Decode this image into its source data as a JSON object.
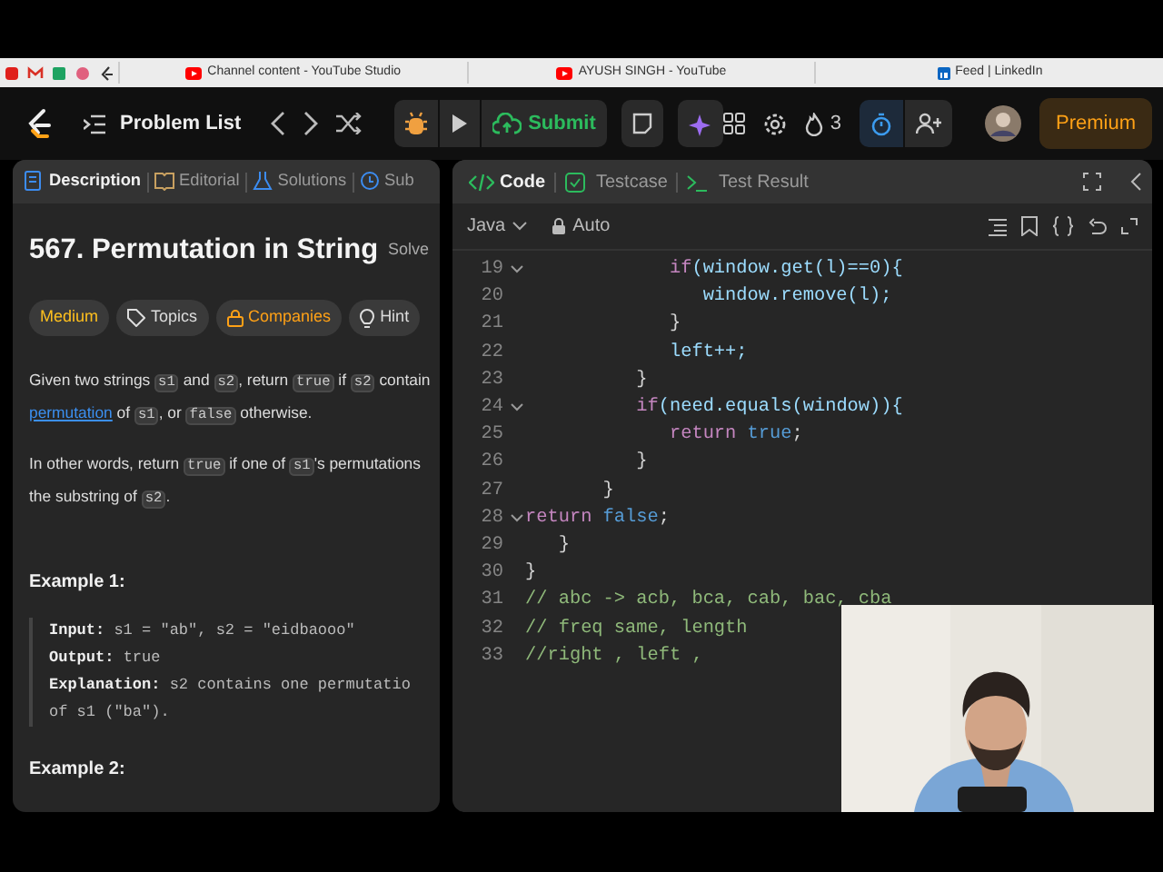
{
  "browser_tabs": [
    {
      "title": "Channel content - YouTube Studio",
      "kind": "youtube"
    },
    {
      "title": "AYUSH SINGH - YouTube",
      "kind": "youtube"
    },
    {
      "title": "Feed | LinkedIn",
      "kind": "linkedin"
    }
  ],
  "navbar": {
    "title": "Problem List",
    "submit": "Submit",
    "streak": "3",
    "premium": "Premium"
  },
  "left_tabs": [
    {
      "label": "Description",
      "selected": true,
      "kind": "doc"
    },
    {
      "label": "Editorial",
      "selected": false,
      "kind": "book"
    },
    {
      "label": "Solutions",
      "selected": false,
      "kind": "flask"
    },
    {
      "label": "Sub",
      "selected": false,
      "kind": "clock"
    }
  ],
  "problem": {
    "title": "567. Permutation in String",
    "status": "Solve",
    "tags": [
      {
        "label": "Medium",
        "kind": "difficulty"
      },
      {
        "label": "Topics",
        "kind": "tag"
      },
      {
        "label": "Companies",
        "kind": "lock"
      },
      {
        "label": "Hint",
        "kind": "bulb"
      }
    ],
    "paragraphs": [
      [
        [
          {
            "kind": "text",
            "text": "Given two strings "
          },
          {
            "kind": "code",
            "text": "s1"
          },
          {
            "kind": "text",
            "text": " and "
          },
          {
            "kind": "code",
            "text": "s2"
          },
          {
            "kind": "text",
            "text": ", return "
          },
          {
            "kind": "code",
            "text": "true"
          },
          {
            "kind": "text",
            "text": " if "
          },
          {
            "kind": "code",
            "text": "s2"
          },
          {
            "kind": "text",
            "text": " contain"
          }
        ],
        [
          {
            "kind": "link",
            "text": "permutation"
          },
          {
            "kind": "text",
            "text": " of "
          },
          {
            "kind": "code",
            "text": "s1"
          },
          {
            "kind": "text",
            "text": ", or "
          },
          {
            "kind": "code",
            "text": "false"
          },
          {
            "kind": "text",
            "text": " otherwise."
          }
        ]
      ],
      [
        [
          {
            "kind": "text",
            "text": "In other words, return "
          },
          {
            "kind": "code",
            "text": "true"
          },
          {
            "kind": "text",
            "text": " if one of "
          },
          {
            "kind": "code",
            "text": "s1"
          },
          {
            "kind": "text",
            "text": "'s permutations"
          }
        ],
        [
          {
            "kind": "text",
            "text": "the substring of "
          },
          {
            "kind": "code",
            "text": "s2"
          },
          {
            "kind": "text",
            "text": "."
          }
        ]
      ]
    ],
    "examples": [
      {
        "title": "Example 1:",
        "lines": [
          [
            {
              "kind": "label",
              "text": "Input:"
            },
            {
              "kind": "text",
              "text": " s1 = \"ab\", s2 = \"eidbaooo\""
            }
          ],
          [
            {
              "kind": "label",
              "text": "Output:"
            },
            {
              "kind": "text",
              "text": " true"
            }
          ],
          [
            {
              "kind": "label",
              "text": "Explanation:"
            },
            {
              "kind": "text",
              "text": " s2 contains one permutatio"
            }
          ],
          [
            {
              "kind": "text",
              "text": "of s1 (\"ba\")."
            }
          ]
        ]
      },
      {
        "title": "Example 2:"
      }
    ]
  },
  "code_tabs": [
    {
      "label": "Code",
      "selected": true,
      "kind": "code"
    },
    {
      "label": "Testcase",
      "selected": false,
      "kind": "check"
    },
    {
      "label": "Test Result",
      "selected": false,
      "kind": "terminal"
    }
  ],
  "editor": {
    "language": "Java",
    "mode": "Auto",
    "lines": [
      {
        "num": "19",
        "expanded": true,
        "tokens": [
          {
            "kind": "keyword",
            "text": "             if"
          },
          {
            "kind": "var",
            "text": "(window.get(l)==0){"
          }
        ]
      },
      {
        "num": "20",
        "tokens": [
          {
            "kind": "var",
            "text": "                window.remove(l);"
          }
        ]
      },
      {
        "num": "21",
        "tokens": [
          {
            "kind": "plain",
            "text": "             }"
          }
        ]
      },
      {
        "num": "22",
        "tokens": [
          {
            "kind": "var",
            "text": "             left++;"
          }
        ]
      },
      {
        "num": "23",
        "tokens": [
          {
            "kind": "plain",
            "text": "          }"
          }
        ]
      },
      {
        "num": "24",
        "expanded": true,
        "tokens": [
          {
            "kind": "keyword",
            "text": "          if"
          },
          {
            "kind": "var",
            "text": "(need.equals(window)){"
          }
        ]
      },
      {
        "num": "25",
        "tokens": [
          {
            "kind": "keyword",
            "text": "             return"
          },
          {
            "kind": "literal",
            "text": " true"
          },
          {
            "kind": "plain",
            "text": ";"
          }
        ]
      },
      {
        "num": "26",
        "tokens": [
          {
            "kind": "plain",
            "text": "          }"
          }
        ]
      },
      {
        "num": "27",
        "tokens": [
          {
            "kind": "plain",
            "text": "       }"
          }
        ]
      },
      {
        "num": "28",
        "expanded": true,
        "tokens": [
          {
            "kind": "keyword",
            "text": "return"
          },
          {
            "kind": "literal",
            "text": " false"
          },
          {
            "kind": "plain",
            "text": ";"
          }
        ]
      },
      {
        "num": "29",
        "tokens": [
          {
            "kind": "plain",
            "text": "   }"
          }
        ]
      },
      {
        "num": "30",
        "tokens": [
          {
            "kind": "plain",
            "text": "}"
          }
        ]
      },
      {
        "num": "31",
        "tokens": [
          {
            "kind": "comment",
            "text": "// abc -> acb, bca, cab, bac, cba"
          }
        ]
      },
      {
        "num": "32",
        "tokens": [
          {
            "kind": "comment",
            "text": "// freq same, length"
          }
        ]
      },
      {
        "num": "33",
        "tokens": [
          {
            "kind": "comment",
            "text": "//right , left ,"
          }
        ]
      }
    ]
  }
}
